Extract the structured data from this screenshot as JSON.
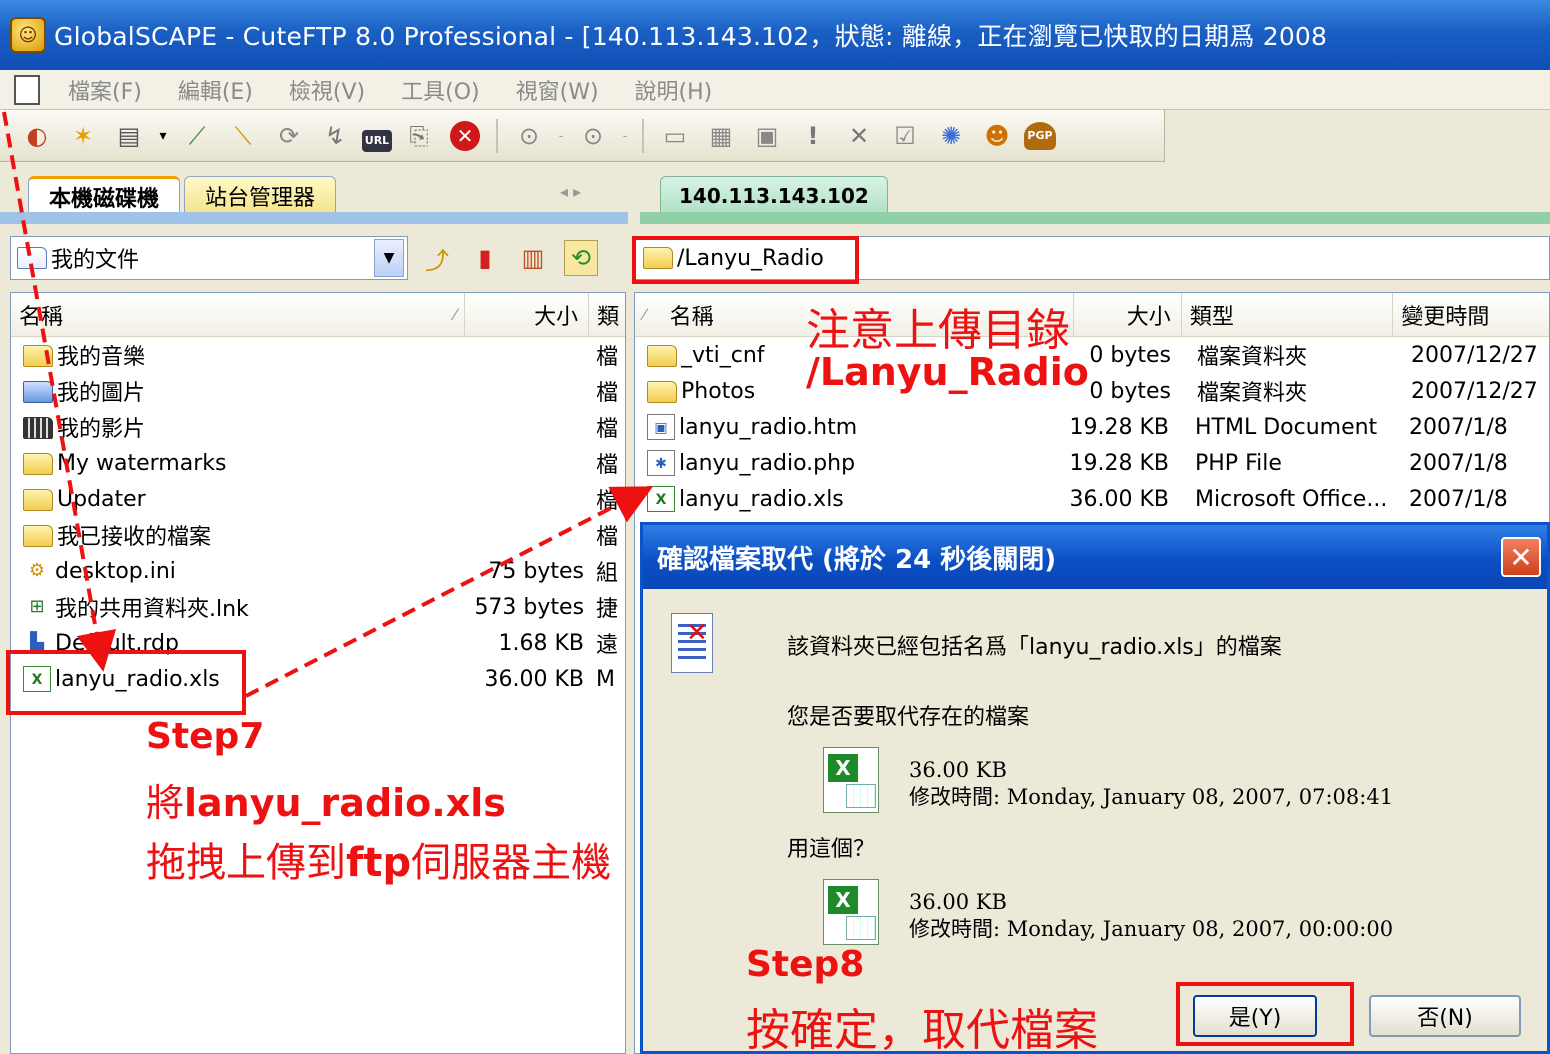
{
  "window": {
    "title": "GlobalSCAPE - CuteFTP 8.0 Professional - [140.113.143.102，狀態: 離線，正在瀏覽已快取的日期爲 2008"
  },
  "menu": [
    "檔案(F)",
    "編輯(E)",
    "檢視(V)",
    "工具(O)",
    "視窗(W)",
    "說明(H)"
  ],
  "toolbar": {
    "icons": [
      "connect-icon",
      "wizard-icon",
      "new-icon",
      "dropdown-icon",
      "quick-connect-icon",
      "disconnect-icon",
      "reconnect-icon",
      "refresh-icon",
      "url-icon",
      "copy-icon",
      "stop-icon",
      "download-icon",
      "upload-icon",
      "edit-icon",
      "view-icon",
      "folder-new-icon",
      "exclamation-icon",
      "delete-icon",
      "check-icon",
      "sync-icon",
      "backup-icon",
      "pgp-icon"
    ],
    "url_label": "URL",
    "pgp_label": "PGP"
  },
  "left_panel": {
    "tabs": [
      {
        "label": "本機磁碟機",
        "active": true
      },
      {
        "label": "站台管理器",
        "active": false
      }
    ],
    "path": "我的文件",
    "columns": [
      "名稱",
      "大小",
      "類"
    ],
    "files": [
      {
        "name": "我的音樂",
        "size": "",
        "type": "檔",
        "icon": "music-folder-icon"
      },
      {
        "name": "我的圖片",
        "size": "",
        "type": "檔",
        "icon": "pictures-folder-icon"
      },
      {
        "name": "我的影片",
        "size": "",
        "type": "檔",
        "icon": "video-folder-icon"
      },
      {
        "name": "My watermarks",
        "size": "",
        "type": "檔",
        "icon": "folder-icon"
      },
      {
        "name": "Updater",
        "size": "",
        "type": "檔",
        "icon": "folder-icon"
      },
      {
        "name": "我已接收的檔案",
        "size": "",
        "type": "檔",
        "icon": "folder-icon"
      },
      {
        "name": "desktop.ini",
        "size": "75 bytes",
        "type": "組",
        "icon": "ini-file-icon"
      },
      {
        "name": "我的共用資料夾.lnk",
        "size": "573 bytes",
        "type": "捷",
        "icon": "shortcut-icon"
      },
      {
        "name": "Default.rdp",
        "size": "1.68 KB",
        "type": "遠",
        "icon": "rdp-file-icon"
      },
      {
        "name": "lanyu_radio.xls",
        "size": "36.00 KB",
        "type": "M",
        "icon": "xls-file-icon"
      }
    ]
  },
  "right_panel": {
    "tab": "140.113.143.102",
    "path": "/Lanyu_Radio",
    "columns": [
      "名稱",
      "大小",
      "類型",
      "變更時間"
    ],
    "files": [
      {
        "name": "_vti_cnf",
        "size": "0 bytes",
        "type": "檔案資料夾",
        "date": "2007/12/27",
        "icon": "folder-icon"
      },
      {
        "name": "Photos",
        "size": "0 bytes",
        "type": "檔案資料夾",
        "date": "2007/12/27",
        "icon": "folder-icon"
      },
      {
        "name": "lanyu_radio.htm",
        "size": "19.28 KB",
        "type": "HTML Document",
        "date": "2007/1/8",
        "icon": "htm-file-icon"
      },
      {
        "name": "lanyu_radio.php",
        "size": "19.28 KB",
        "type": "PHP File",
        "date": "2007/1/8",
        "icon": "php-file-icon"
      },
      {
        "name": "lanyu_radio.xls",
        "size": "36.00 KB",
        "type": "Microsoft Office...",
        "date": "2007/1/8",
        "icon": "xls-file-icon"
      }
    ]
  },
  "dialog": {
    "title": "確認檔案取代 (將於 24 秒後關閉)",
    "message": "該資料夾已經包括名爲「lanyu_radio.xls」的檔案",
    "question": "您是否要取代存在的檔案",
    "existing_size": "36.00 KB",
    "existing_modified": "修改時間: Monday, January 08, 2007, 07:08:41",
    "use_this": "用這個？",
    "new_size": "36.00 KB",
    "new_modified": "修改時間: Monday, January 08, 2007, 00:00:00",
    "yes_label": "是(Y)",
    "no_label": "否(N)"
  },
  "annotations": {
    "upload_dir_note": "注意上傳目錄",
    "upload_dir_path": "/Lanyu_Radio",
    "step7_title": "Step7",
    "step7_line1_prefix": "將",
    "step7_line1_file": "lanyu_radio.xls",
    "step7_line2_prefix": "拖拽上傳到",
    "step7_line2_ftp": "ftp",
    "step7_line2_suffix": "伺服器主機",
    "step8_title": "Step8",
    "step8_text": "按確定，取代檔案",
    "color": "#ee1111"
  }
}
